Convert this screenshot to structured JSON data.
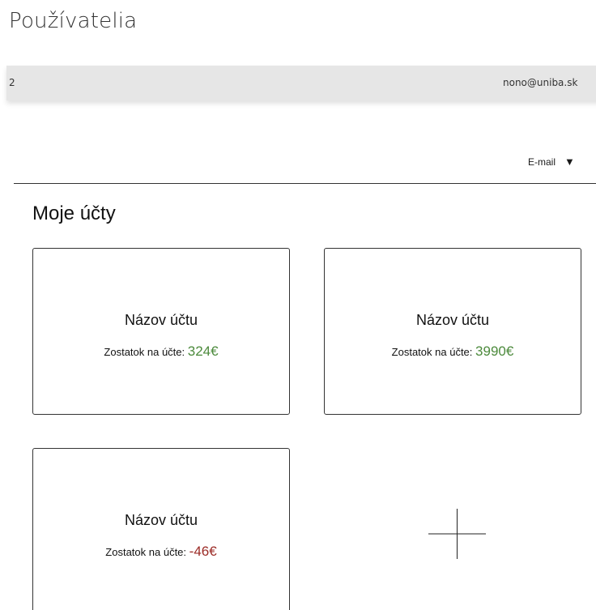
{
  "page": {
    "title": "Používatelia"
  },
  "user_row": {
    "id": "2",
    "email": "nono@uniba.sk"
  },
  "sort": {
    "selected": "E-mail",
    "caret": "▼"
  },
  "accounts_section": {
    "title": "Moje účty",
    "balance_label": "Zostatok na účte:",
    "accounts": [
      {
        "name": "Názov účtu",
        "balance": "324€",
        "status": "positive"
      },
      {
        "name": "Názov účtu",
        "balance": "3990€",
        "status": "positive"
      },
      {
        "name": "Názov účtu",
        "balance": "-46€",
        "status": "negative"
      }
    ],
    "add_icon": "plus-icon"
  },
  "colors": {
    "positive": "#4c8a3c",
    "negative": "#9b2a25",
    "row_background": "#e6e6e6"
  }
}
